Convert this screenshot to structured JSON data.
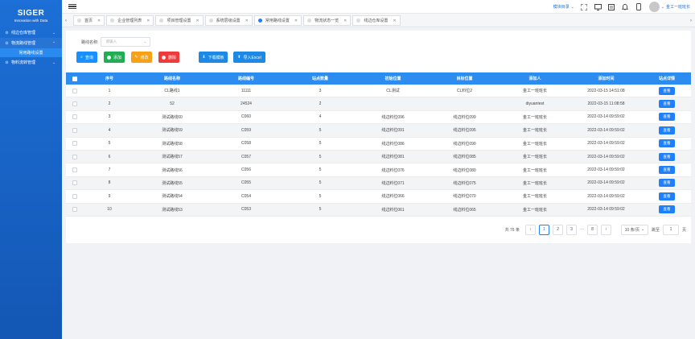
{
  "sidebar": {
    "brand": "SIGER",
    "tagline": "Innovation with Data",
    "items": [
      {
        "label": "线边仓库管理",
        "chevron": "⌄"
      },
      {
        "label": "物流路线管理",
        "chevron": "⌃"
      },
      {
        "label": "常用路线设置"
      },
      {
        "label": "物料流转管理",
        "chevron": "⌄"
      }
    ]
  },
  "topbar": {
    "module_nav": "模块目录",
    "user_name": "金工一班班长"
  },
  "tabs": [
    {
      "label": "首页"
    },
    {
      "label": "企业管理列表"
    },
    {
      "label": "项目管理设置"
    },
    {
      "label": "系统层级设置"
    },
    {
      "label": "常用路线设置",
      "active": true
    },
    {
      "label": "物流状态一览"
    },
    {
      "label": "线边仓库设置"
    }
  ],
  "filter": {
    "label": "路线名称:",
    "placeholder": "请输入"
  },
  "buttons": {
    "query": "查询",
    "add": "添加",
    "edit": "修改",
    "delete": "删除",
    "download": "下载模板",
    "import": "导入Excel"
  },
  "table": {
    "headers": [
      "序号",
      "路线名称",
      "路线编号",
      "站点数量",
      "初始位置",
      "目标位置",
      "添加人",
      "添加时间",
      "站点详情"
    ],
    "view_label": "查看",
    "rows": [
      [
        "1",
        "CL路线1",
        "11111",
        "3",
        "CL测试",
        "CL料位2",
        "金工一班班长",
        "2022-03-15 14:51:08"
      ],
      [
        "2",
        "52",
        "24524",
        "2",
        "",
        "",
        "diyuantest",
        "2022-03-15 11:08:58"
      ],
      [
        "3",
        "测试路线60",
        "C060",
        "4",
        "线边料位096",
        "线边料位099",
        "金工一班班长",
        "2022-03-14 09:59:02"
      ],
      [
        "4",
        "测试路线59",
        "C059",
        "5",
        "线边料位091",
        "线边料位095",
        "金工一班班长",
        "2022-03-14 09:59:02"
      ],
      [
        "5",
        "测试路线58",
        "C058",
        "5",
        "线边料位086",
        "线边料位090",
        "金工一班班长",
        "2022-03-14 09:59:02"
      ],
      [
        "6",
        "测试路线57",
        "C057",
        "5",
        "线边料位081",
        "线边料位085",
        "金工一班班长",
        "2022-03-14 09:59:02"
      ],
      [
        "7",
        "测试路线56",
        "C056",
        "5",
        "线边料位076",
        "线边料位080",
        "金工一班班长",
        "2022-03-14 09:59:02"
      ],
      [
        "8",
        "测试路线55",
        "C055",
        "5",
        "线边料位071",
        "线边料位075",
        "金工一班班长",
        "2022-03-14 09:59:02"
      ],
      [
        "9",
        "测试路线54",
        "C054",
        "5",
        "线边料位066",
        "线边料位070",
        "金工一班班长",
        "2022-03-14 09:59:02"
      ],
      [
        "10",
        "测试路线53",
        "C053",
        "5",
        "线边料位061",
        "线边料位065",
        "金工一班班长",
        "2022-03-14 09:59:02"
      ]
    ]
  },
  "pagination": {
    "total": "共 76 条",
    "pages": [
      "1",
      "2",
      "3",
      "···",
      "8"
    ],
    "current": "1",
    "page_size": "10 条/页",
    "goto_label": "跳至",
    "goto_value": "1",
    "page_suffix": "页"
  },
  "colors": {
    "sidebar": "#1c6fd6",
    "header": "#2d8cf0",
    "query": "#1890ff",
    "add": "#21ad53",
    "edit": "#f7a116",
    "delete": "#ee3b3b"
  }
}
